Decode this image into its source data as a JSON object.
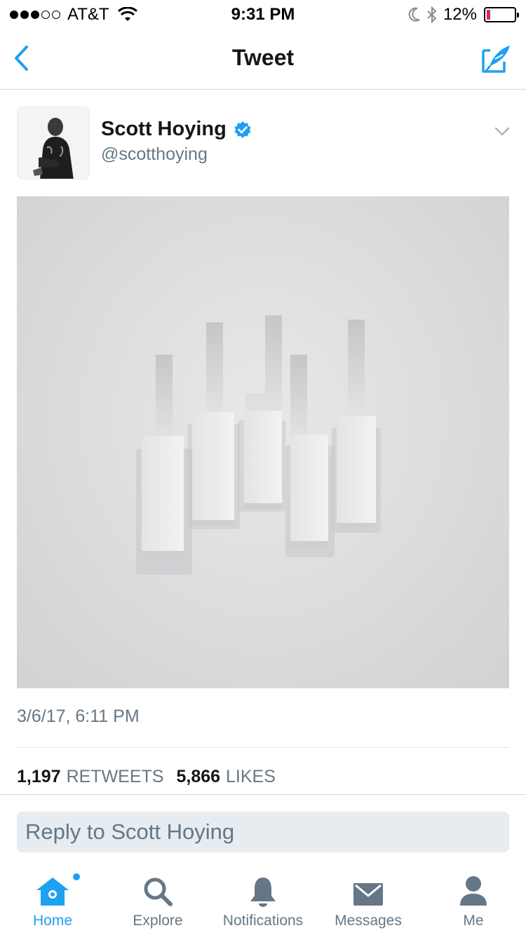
{
  "status_bar": {
    "carrier": "AT&T",
    "time": "9:31 PM",
    "battery_percent": "12%",
    "battery_level": 0.12,
    "signal_bars_filled": 3,
    "signal_bars_total": 5
  },
  "nav": {
    "title": "Tweet"
  },
  "tweet": {
    "user_name": "Scott Hoying",
    "verified": true,
    "handle": "@scotthoying",
    "timestamp": "3/6/17, 6:11 PM",
    "retweets_count": "1,197",
    "retweets_label": "RETWEETS",
    "likes_count": "5,866",
    "likes_label": "LIKES"
  },
  "reply": {
    "placeholder": "Reply to Scott Hoying"
  },
  "tabs": [
    {
      "label": "Home",
      "icon": "home-icon",
      "active": true,
      "has_dot": true
    },
    {
      "label": "Explore",
      "icon": "search-icon",
      "active": false
    },
    {
      "label": "Notifications",
      "icon": "bell-icon",
      "active": false
    },
    {
      "label": "Messages",
      "icon": "envelope-icon",
      "active": false
    },
    {
      "label": "Me",
      "icon": "person-icon",
      "active": false
    }
  ],
  "colors": {
    "accent": "#1da1f2",
    "text_primary": "#14171a",
    "text_secondary": "#657786",
    "battery_low": "#e0245e"
  }
}
